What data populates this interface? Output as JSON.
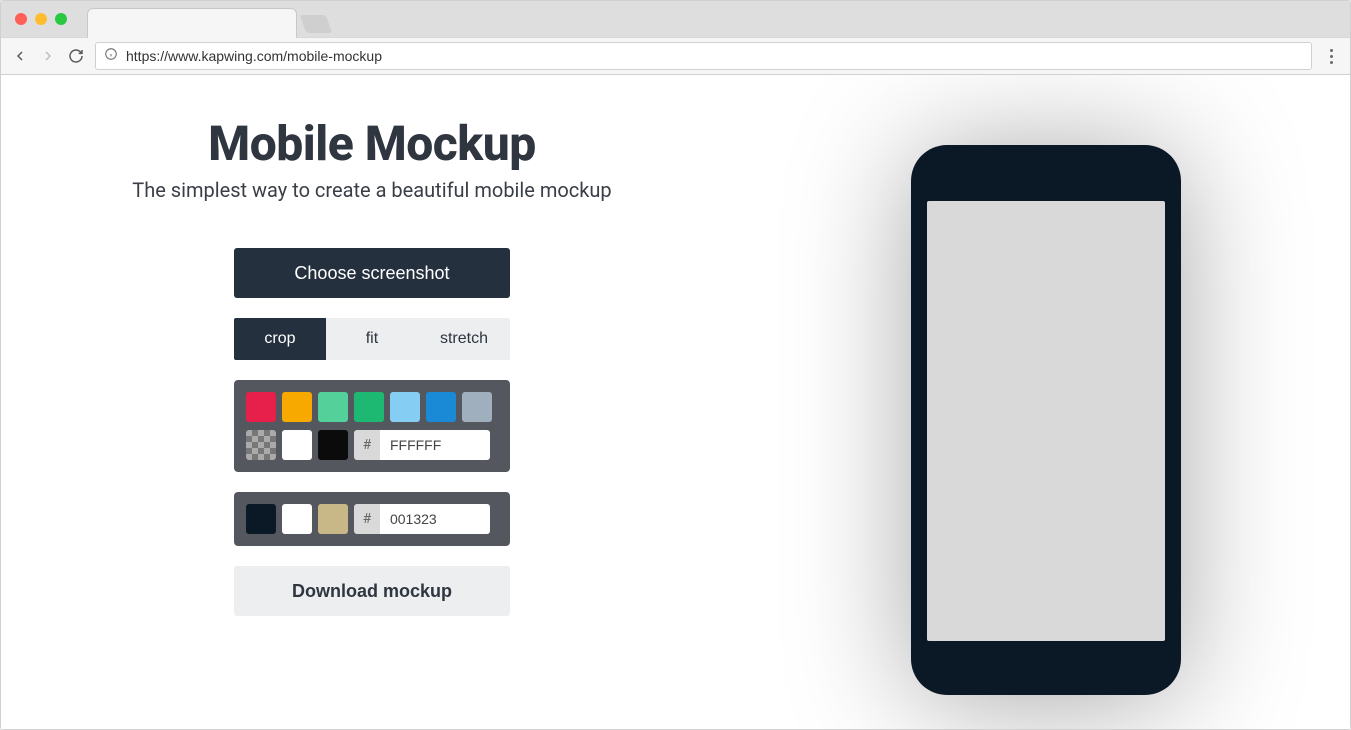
{
  "browser": {
    "url": "https://www.kapwing.com/mobile-mockup"
  },
  "header": {
    "title": "Mobile Mockup",
    "subtitle": "The simplest way to create a beautiful mobile mockup"
  },
  "actions": {
    "choose_label": "Choose screenshot",
    "download_label": "Download mockup"
  },
  "fit_modes": {
    "options": [
      "crop",
      "fit",
      "stretch"
    ],
    "active": "crop"
  },
  "bg_palette": {
    "colors_row1": [
      "#e6204b",
      "#f8a900",
      "#54d19a",
      "#1db973",
      "#86cdf4",
      "#1a89d6",
      "#9fafbd"
    ],
    "colors_row2_special": [
      "checker",
      "#ffffff",
      "#0b0b0b"
    ],
    "hex_prefix": "#",
    "hex_value": "FFFFFF"
  },
  "frame_palette": {
    "colors": [
      "#0b1826",
      "#ffffff",
      "#c9b887"
    ],
    "hex_prefix": "#",
    "hex_value": "001323"
  },
  "phone": {
    "frame_color": "#0b1826",
    "screen_color": "#d9d9d9"
  }
}
